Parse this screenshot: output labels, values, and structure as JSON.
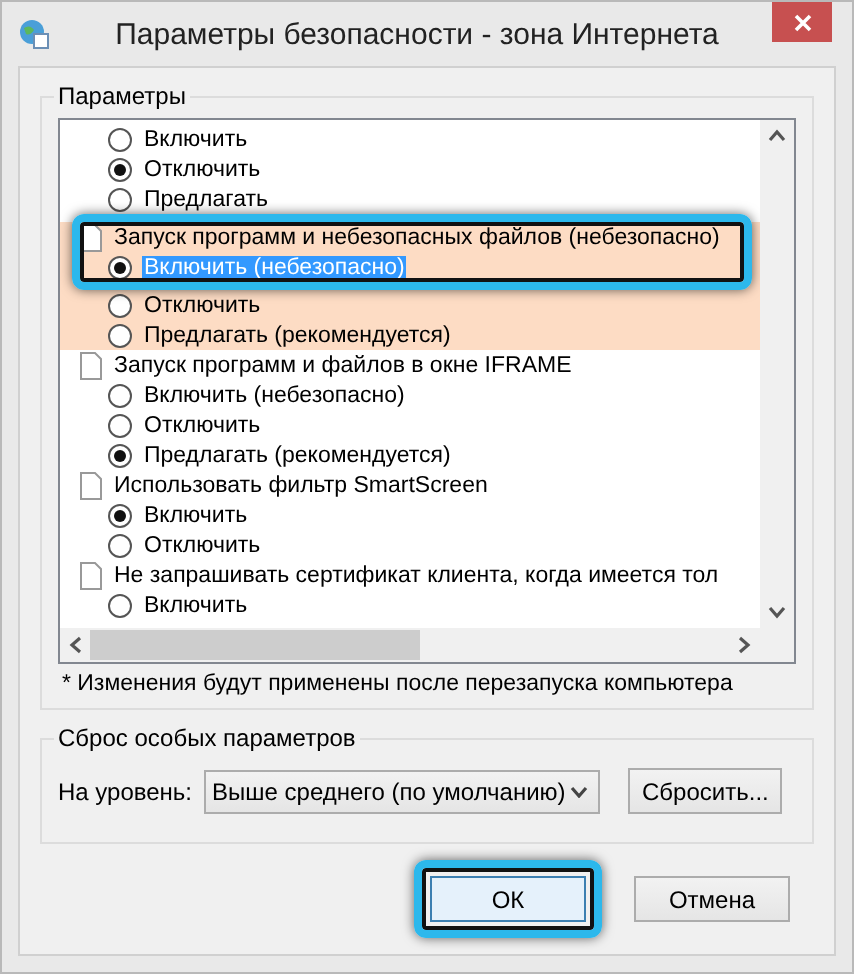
{
  "window": {
    "title": "Параметры безопасности - зона Интернета"
  },
  "settings_group": {
    "label": "Параметры",
    "settings": [
      {
        "options": [
          {
            "label": "Включить",
            "selected": false,
            "focused": false
          },
          {
            "label": "Отключить",
            "selected": true,
            "focused": false
          },
          {
            "label": "Предлагать",
            "selected": false,
            "focused": false
          }
        ],
        "highlighted": false,
        "framed": false
      },
      {
        "title": "Запуск программ и небезопасных файлов (небезопасно)",
        "highlighted": true,
        "framed": true,
        "options": [
          {
            "label": "Включить (небезопасно)",
            "selected": true,
            "focused": true
          },
          {
            "label": "Отключить",
            "selected": false,
            "focused": false
          },
          {
            "label": "Предлагать (рекомендуется)",
            "selected": false,
            "focused": false
          }
        ]
      },
      {
        "title": "Запуск программ и файлов в окне IFRAME",
        "highlighted": false,
        "framed": false,
        "options": [
          {
            "label": "Включить (небезопасно)",
            "selected": false,
            "focused": false
          },
          {
            "label": "Отключить",
            "selected": false,
            "focused": false
          },
          {
            "label": "Предлагать (рекомендуется)",
            "selected": true,
            "focused": false
          }
        ]
      },
      {
        "title": "Использовать фильтр SmartScreen",
        "highlighted": false,
        "framed": false,
        "options": [
          {
            "label": "Включить",
            "selected": true,
            "focused": false
          },
          {
            "label": "Отключить",
            "selected": false,
            "focused": false
          }
        ]
      },
      {
        "title": "Не запрашивать сертификат клиента, когда имеется тол",
        "highlighted": false,
        "framed": false,
        "options": [
          {
            "label": "Включить",
            "selected": false,
            "focused": false
          }
        ]
      }
    ],
    "note": "* Изменения будут применены после перезапуска компьютера"
  },
  "reset_group": {
    "label": "Сброс особых параметров",
    "level_label": "На уровень:",
    "level_value": "Выше среднего (по умолчанию)",
    "reset_button": "Сбросить..."
  },
  "buttons": [
    {
      "label": "ОК",
      "framed": true
    },
    {
      "label": "Отмена",
      "framed": false
    }
  ]
}
